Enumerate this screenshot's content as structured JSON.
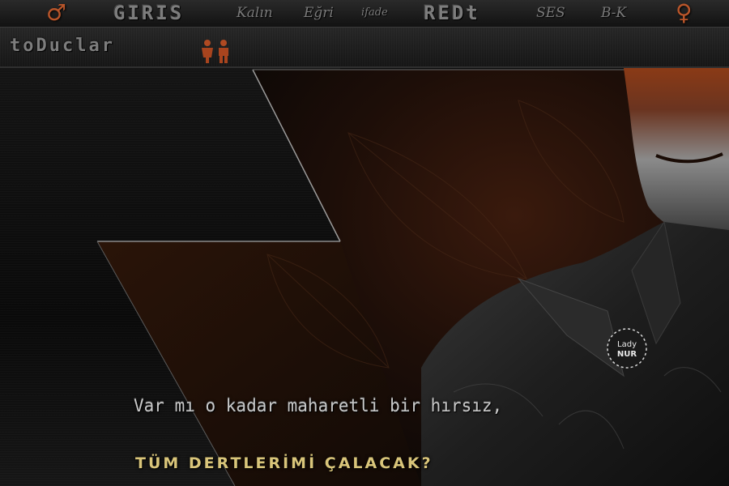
{
  "topbar": {
    "items": [
      {
        "label": "GIRIS"
      },
      {
        "label": "Kalın"
      },
      {
        "label": "Eğri"
      },
      {
        "label": "ifade"
      },
      {
        "label": "REDt"
      },
      {
        "label": "SES"
      },
      {
        "label": "B-K"
      }
    ],
    "icons": {
      "left": "male-symbol",
      "right": "female-symbol"
    }
  },
  "bar2": {
    "label": "toDuclar",
    "icon": "users-icon"
  },
  "canvas": {
    "lyric_line_1": "Var mı o kadar maharetli bir hırsız,",
    "lyric_line_2": "TÜM DERTLERİMİ ÇALACAK?",
    "badge_line_1": "Lady",
    "badge_line_2": "NUR"
  },
  "colors": {
    "accent": "#b8552a",
    "lyric_gold": "#d9c57a",
    "background": "#0b0b0b"
  }
}
